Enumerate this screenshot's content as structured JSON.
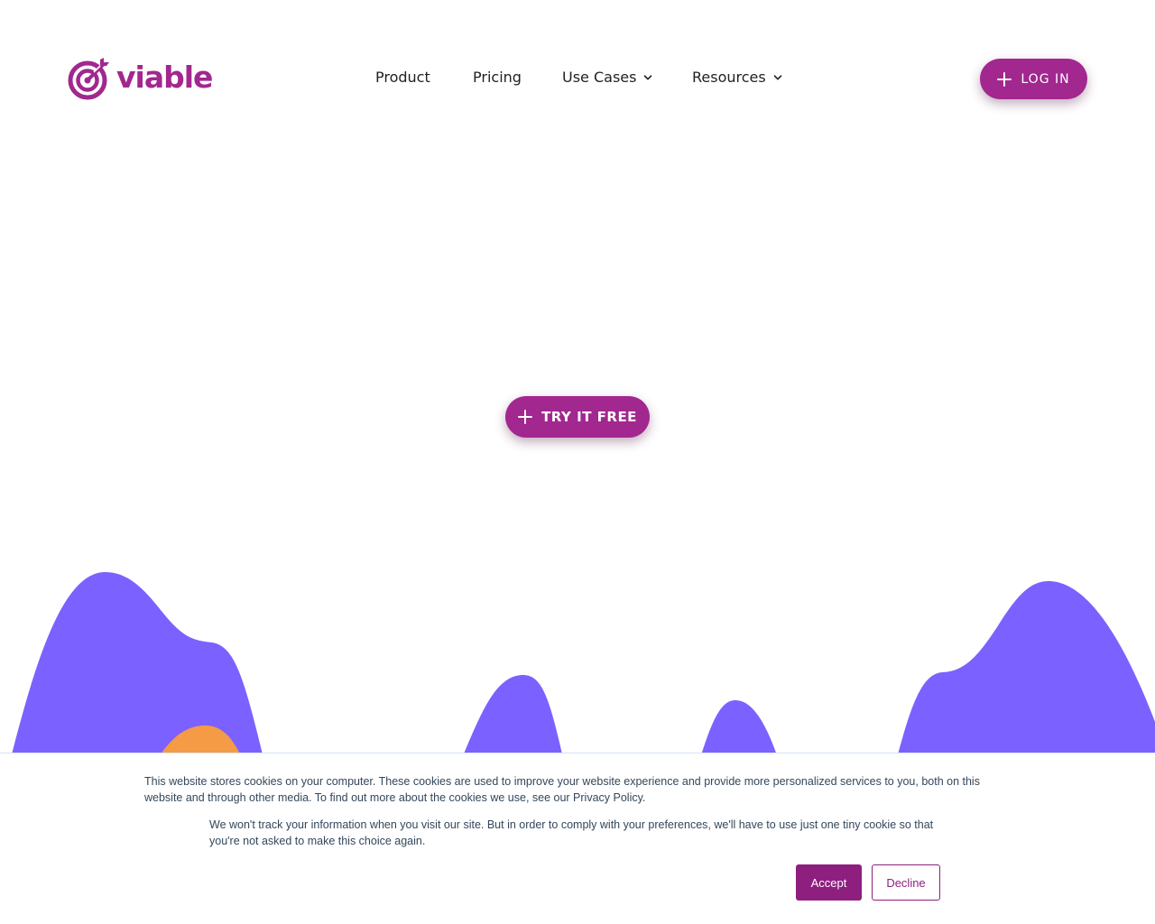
{
  "brand": {
    "name": "viable",
    "color": "#a2278f"
  },
  "nav": {
    "items": [
      {
        "label": "Product",
        "has_dropdown": false
      },
      {
        "label": "Pricing",
        "has_dropdown": false
      },
      {
        "label": "Use Cases",
        "has_dropdown": true
      },
      {
        "label": "Resources",
        "has_dropdown": true
      }
    ]
  },
  "header": {
    "login_label": "LOG IN",
    "login_icon": "plus-icon"
  },
  "hero": {
    "cta_label": "TRY IT FREE",
    "cta_icon": "plus-icon"
  },
  "decor": {
    "hill_color": "#7b61ff",
    "accent_color": "#f59a45"
  },
  "cookie_banner": {
    "text_primary": "This website stores cookies on your computer. These cookies are used to improve your website experience and provide more personalized services to you, both on this website and through other media. To find out more about the cookies we use, see our Privacy Policy.",
    "text_secondary": "We won't track your information when you visit our site. But in order to comply with your preferences, we'll have to use just one tiny cookie so that you're not asked to make this choice again.",
    "accept_label": "Accept",
    "decline_label": "Decline",
    "button_color": "#8e1f7f"
  }
}
